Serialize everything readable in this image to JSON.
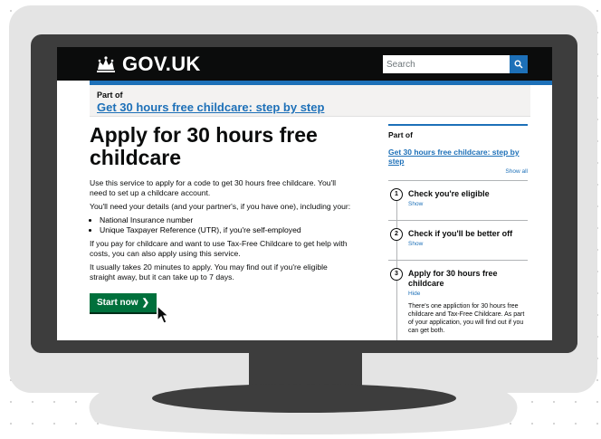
{
  "header": {
    "logo_text": "GOV.UK",
    "search_placeholder": "Search"
  },
  "partof": {
    "label": "Part of",
    "link": "Get 30 hours free childcare: step by step"
  },
  "main": {
    "title": "Apply for 30 hours free childcare",
    "intro": "Use this service to apply for a code to get 30 hours free childcare. You'll need to set up a childcare account.",
    "need_details": "You'll need your details (and your partner's, if you have one), including your:",
    "bullets": [
      "National Insurance number",
      "Unique Taxpayer Reference (UTR), if you're self-employed"
    ],
    "taxfree": "If you pay for childcare and want to use Tax-Free Childcare to get help with costs, you can also apply using this service.",
    "time": "It usually takes 20 minutes to apply. You may find out if you're eligible straight away, but it can take up to 7 days.",
    "start_button": "Start now",
    "start_arrow": "❯"
  },
  "sidebar": {
    "partof_label": "Part of",
    "link": "Get 30 hours free childcare: step by step",
    "show_all": "Show all",
    "steps": [
      {
        "num": "1",
        "title": "Check you're eligible",
        "toggle": "Show"
      },
      {
        "num": "2",
        "title": "Check if you'll be better off",
        "toggle": "Show"
      },
      {
        "num": "3",
        "title": "Apply for 30 hours free childcare",
        "toggle": "Hide",
        "desc": "There's one appliction for 30 hours free childcare and Tax-Free Childcare. As part of your application, you will find out if you can get both."
      }
    ]
  },
  "colors": {
    "header_bg": "#0b0c0c",
    "link_blue": "#1d70b8",
    "start_green": "#00703c",
    "monitor": "#3d3d3d"
  },
  "icons": {
    "logo": "crown-icon",
    "search": "search-icon",
    "cursor": "mouse-pointer-icon"
  }
}
